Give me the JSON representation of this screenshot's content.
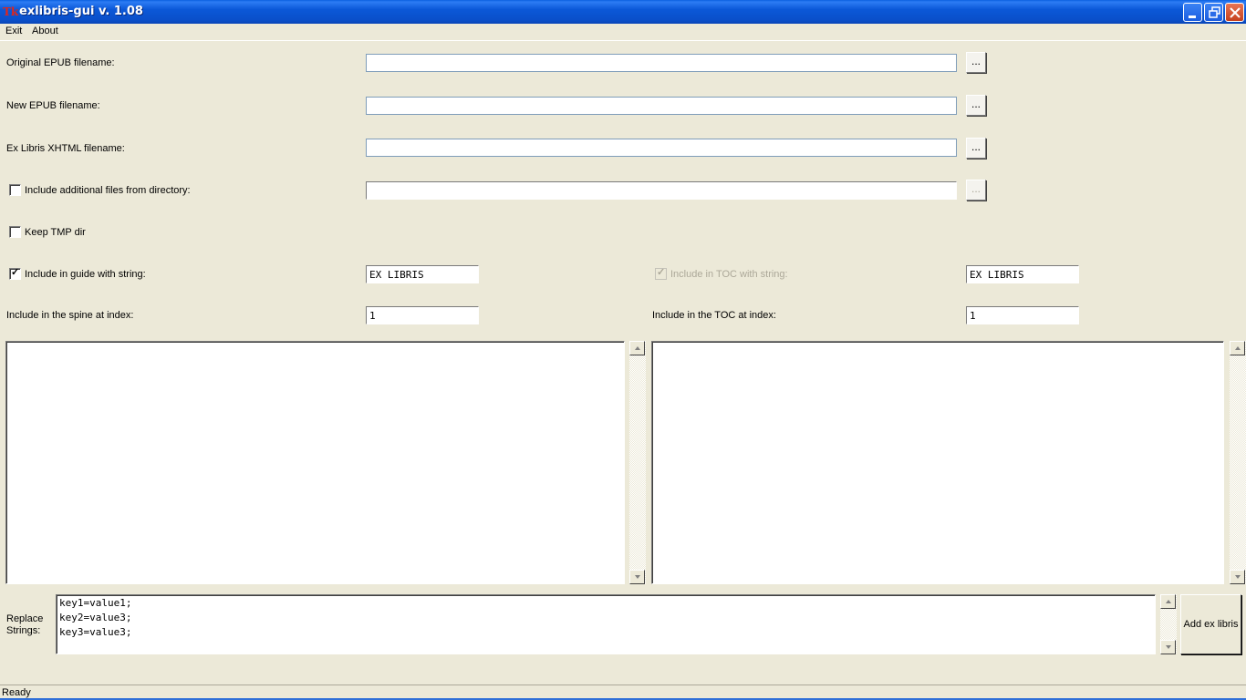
{
  "window": {
    "title": "exlibris-gui v. 1.08",
    "icon": "tk-feather-icon",
    "accent_color": "#0a5fe0"
  },
  "menu": {
    "items": [
      {
        "label": "Exit"
      },
      {
        "label": "About"
      }
    ]
  },
  "form": {
    "original_epub": {
      "label": "Original EPUB filename:",
      "value": "",
      "browse_label": "..."
    },
    "new_epub": {
      "label": "New EPUB filename:",
      "value": "",
      "browse_label": "..."
    },
    "exlibris_xhtml": {
      "label": "Ex Libris XHTML filename:",
      "value": "",
      "browse_label": "..."
    },
    "additional_files": {
      "label": "Include additional files from directory:",
      "checked": false,
      "value": "",
      "browse_label": "..."
    },
    "keep_tmp": {
      "label": "Keep TMP dir",
      "checked": false
    },
    "guide": {
      "label": "Include in guide with string:",
      "checked": true,
      "value": "EX LIBRIS"
    },
    "toc_string": {
      "label": "Include in TOC with string:",
      "checked": true,
      "disabled": true,
      "value": "EX LIBRIS"
    },
    "spine_index": {
      "label": "Include in the spine at index:",
      "value": "1"
    },
    "toc_index": {
      "label": "Include in the TOC at index:",
      "value": "1"
    }
  },
  "replace": {
    "label_line1": "Replace",
    "label_line2": "Strings:",
    "text": "key1=value1;\nkey2=value3;\nkey3=value3;"
  },
  "actions": {
    "add_label": "Add ex libris"
  },
  "status": {
    "text": "Ready"
  }
}
